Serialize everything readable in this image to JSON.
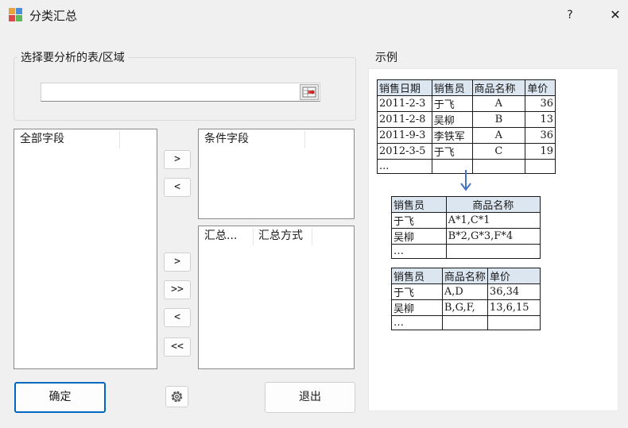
{
  "window": {
    "title": "分类汇总",
    "help_label": "?",
    "close_label": "✕"
  },
  "source_group": {
    "label": "选择要分析的表/区域",
    "range_value": ""
  },
  "all_fields": {
    "header": "全部字段"
  },
  "condition_fields": {
    "header": "条件字段"
  },
  "summary_fields": {
    "header1": "汇总...",
    "header2": "汇总方式"
  },
  "buttons": {
    "add_condition": ">",
    "remove_condition": "<",
    "add_summary": ">",
    "add_all_summary": ">>",
    "remove_summary": "<",
    "remove_all_summary": "<<",
    "ok": "确定",
    "exit": "退出"
  },
  "example": {
    "label": "示例",
    "table1": {
      "headers": [
        "销售日期",
        "销售员",
        "商品名称",
        "单价"
      ],
      "rows": [
        [
          "2011-2-3",
          "于飞",
          "A",
          "36"
        ],
        [
          "2011-2-8",
          "吴柳",
          "B",
          "13"
        ],
        [
          "2011-9-3",
          "李铁军",
          "A",
          "36"
        ],
        [
          "2012-3-5",
          "于飞",
          "C",
          "19"
        ],
        [
          "...",
          "",
          "",
          ""
        ]
      ]
    },
    "table2": {
      "headers": [
        "销售员",
        "商品名称"
      ],
      "rows": [
        [
          "于飞",
          "A*1,C*1"
        ],
        [
          "吴柳",
          "B*2,G*3,F*4"
        ],
        [
          "…",
          ""
        ]
      ]
    },
    "table3": {
      "headers": [
        "销售员",
        "商品名称",
        "单价"
      ],
      "rows": [
        [
          "于飞",
          "A,D",
          "36,34"
        ],
        [
          "吴柳",
          "B,G,F,",
          "13,6,15"
        ],
        [
          "…",
          "",
          ""
        ]
      ]
    }
  },
  "colors": {
    "accent": "#0067c0",
    "arrow": "#4472c4",
    "header_fill": "#dce6f1"
  }
}
